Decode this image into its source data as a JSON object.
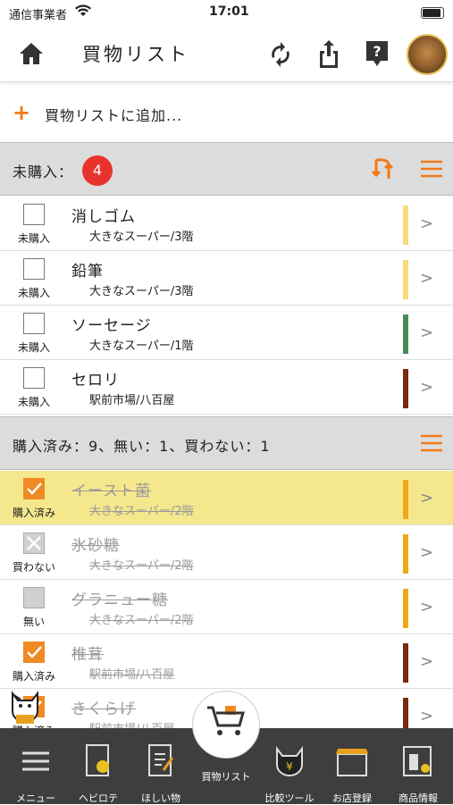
{
  "status": {
    "carrier": "通信事業者",
    "time": "17:01"
  },
  "nav": {
    "title": "買物リスト"
  },
  "add": {
    "label": "買物リストに追加..."
  },
  "unpurchased": {
    "label": "未購入：",
    "count": "4"
  },
  "purchased": {
    "label": "購入済み：9、無い：1、買わない：1"
  },
  "items": [
    {
      "name": "消しゴム",
      "store": "大きなスーパー/3階",
      "status": "未購入",
      "state": "none",
      "color": "#f6db7a"
    },
    {
      "name": "鉛筆",
      "store": "大きなスーパー/3階",
      "status": "未購入",
      "state": "none",
      "color": "#f6db7a"
    },
    {
      "name": "ソーセージ",
      "store": "大きなスーパー/1階",
      "status": "未購入",
      "state": "none",
      "color": "#4a8a5a"
    },
    {
      "name": "セロリ",
      "store": "駅前市場/八百屋",
      "status": "未購入",
      "state": "none",
      "color": "#7a2a10"
    }
  ],
  "done_items": [
    {
      "name": "イースト菌",
      "store": "大きなスーパー/2階",
      "status": "購入済み",
      "state": "on",
      "color": "#f0a818",
      "highlight": true
    },
    {
      "name": "氷砂糖",
      "store": "大きなスーパー/2階",
      "status": "買わない",
      "state": "x",
      "color": "#f0a818"
    },
    {
      "name": "グラニュー糖",
      "store": "大きなスーパー/2階",
      "status": "無い",
      "state": "grey",
      "color": "#f0a818"
    },
    {
      "name": "椎茸",
      "store": "駅前市場/八百屋",
      "status": "購入済み",
      "state": "on",
      "color": "#7a2a10"
    },
    {
      "name": "きくらげ",
      "store": "駅前市場/八百屋",
      "status": "購入済み",
      "state": "on",
      "color": "#7a2a10"
    }
  ],
  "tabs": [
    {
      "label": "メニュー",
      "icon": "menu-icon"
    },
    {
      "label": "ヘビロテ",
      "icon": "heavy-rotation-icon"
    },
    {
      "label": "ほしい物",
      "icon": "wishlist-icon"
    },
    {
      "label": "買物リスト",
      "icon": "cart-icon"
    },
    {
      "label": "比較ツール",
      "icon": "compare-tool-icon"
    },
    {
      "label": "お店登録",
      "icon": "store-register-icon"
    },
    {
      "label": "商品情報",
      "icon": "product-info-icon"
    }
  ]
}
